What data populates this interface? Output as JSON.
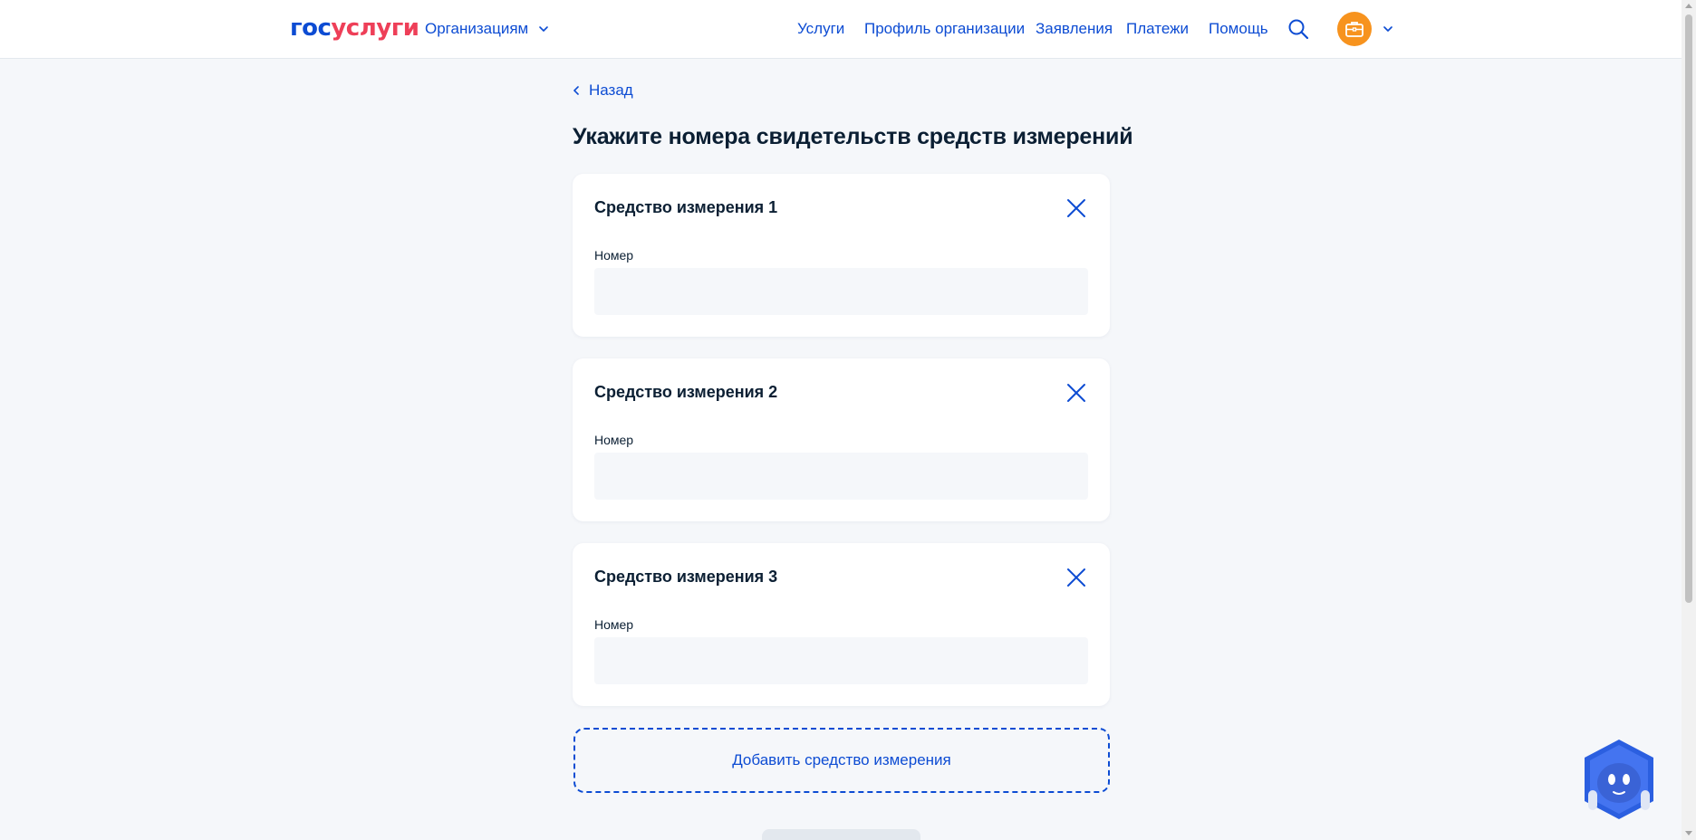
{
  "header": {
    "logo_part1": "гос",
    "logo_part2": "услуги",
    "org_menu_label": "Организациям",
    "nav": [
      {
        "label": "Услуги"
      },
      {
        "label": "Профиль организации"
      },
      {
        "label": "Заявления"
      },
      {
        "label": "Платежи"
      },
      {
        "label": "Помощь"
      }
    ]
  },
  "main": {
    "back_label": "Назад",
    "title": "Укажите номера свидетельств средств измерений",
    "cards": [
      {
        "title": "Средство измерения 1",
        "field_label": "Номер",
        "value": ""
      },
      {
        "title": "Средство измерения 2",
        "field_label": "Номер",
        "value": ""
      },
      {
        "title": "Средство измерения 3",
        "field_label": "Номер",
        "value": ""
      }
    ],
    "add_button_label": "Добавить средство измерения"
  },
  "colors": {
    "accent": "#0d4cd3",
    "brand_red": "#ee3f58",
    "avatar": "#f7931e",
    "background": "#f5f7fa"
  }
}
